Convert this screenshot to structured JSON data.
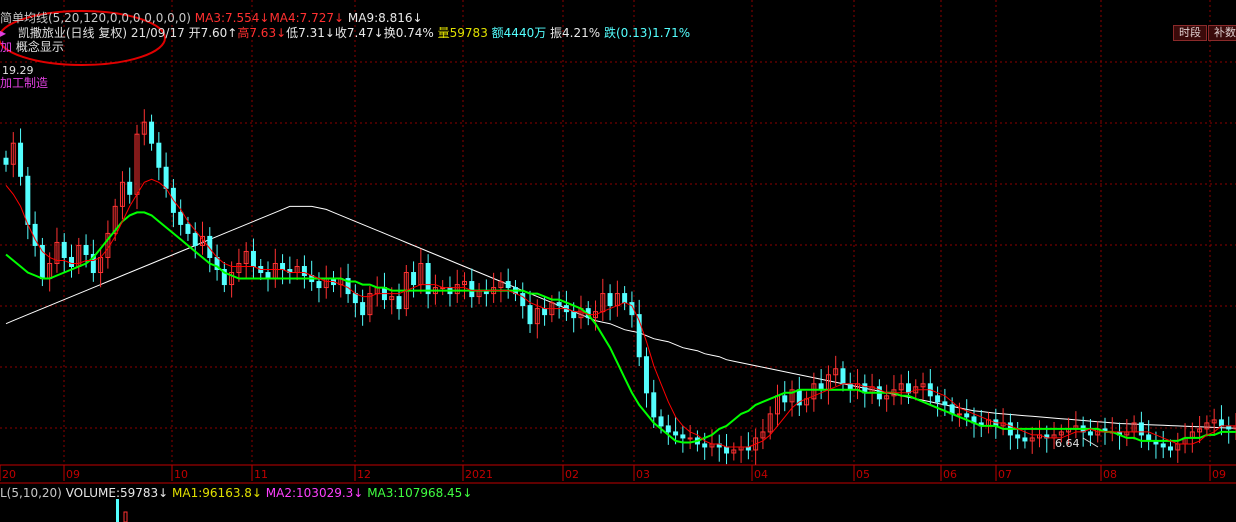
{
  "header": {
    "indicator_name": "简单均线(5,20,120,0,0,0,0,0,0,0)",
    "ma3": "MA3:7.554↓",
    "ma4": "MA4:7.727↓",
    "ma9": "MA9:8.816↓",
    "stock_line": "凯撒旅业(日线 复权) 21/09/17",
    "open": "开7.60↑",
    "high": "高7.63↓",
    "low": "低7.31↓",
    "close": "收7.47↓",
    "turnover": "换0.74%",
    "volume": "量59783",
    "amount": "额4440万",
    "amplitude": "振4.21%",
    "change": "跌(0.13)1.71%",
    "concept_prefix": "加",
    "concept_label": "概念显示",
    "industry": "加工制造"
  },
  "buttons": {
    "timeframe": "时段",
    "supplement": "补数据"
  },
  "volume_header": {
    "params": "L(5,10,20)",
    "volume": "VOLUME:59783↓",
    "ma1": "MA1:96163.8↓",
    "ma2": "MA2:103029.3↓",
    "ma3": "MA3:107968.45↓"
  },
  "colors": {
    "up": "#ff3232",
    "down": "#54ffff",
    "ma_short": "#ff0000",
    "ma_mid": "#00ff00",
    "ma_long": "#ffffff",
    "grid": "#8b0000",
    "axis": "#c00000"
  },
  "chart_data": {
    "type": "candlestick",
    "stock": "凯撒旅业",
    "x_tick_labels": [
      "20",
      "09",
      "10",
      "11",
      "12",
      "2021",
      "02",
      "03",
      "04",
      "05",
      "06",
      "07",
      "08",
      "09"
    ],
    "annotations": {
      "high_marker": "19.29",
      "low_marker": "6.64"
    },
    "y_range": [
      6.3,
      19.6
    ],
    "close": [
      16.2,
      16.9,
      15.8,
      14.2,
      13.5,
      12.4,
      12.9,
      13.6,
      13.1,
      12.8,
      13.5,
      13.2,
      12.6,
      13.1,
      13.9,
      14.8,
      15.6,
      15.2,
      17.2,
      17.6,
      16.9,
      16.1,
      15.4,
      14.6,
      14.2,
      13.9,
      13.5,
      13.8,
      13.1,
      12.7,
      12.2,
      12.6,
      12.9,
      13.3,
      12.8,
      12.6,
      12.4,
      12.9,
      12.7,
      12.6,
      12.8,
      12.5,
      12.3,
      12.1,
      12.4,
      12.2,
      12.4,
      11.9,
      11.6,
      11.2,
      11.9,
      12.1,
      11.7,
      11.8,
      11.4,
      12.6,
      12.2,
      12.9,
      11.9,
      12.1,
      12.1,
      11.9,
      12.2,
      12.3,
      11.8,
      12.0,
      11.9,
      12.1,
      12.3,
      12.1,
      11.9,
      11.5,
      10.9,
      11.4,
      11.2,
      11.6,
      11.5,
      11.3,
      11.1,
      11.4,
      11.1,
      11.3,
      11.9,
      11.5,
      11.9,
      11.6,
      11.2,
      9.8,
      8.6,
      7.8,
      7.5,
      7.3,
      7.2,
      7.1,
      7.1,
      6.9,
      6.8,
      6.9,
      6.8,
      6.6,
      6.7,
      6.8,
      6.7,
      7.1,
      7.3,
      7.9,
      8.5,
      8.3,
      8.7,
      8.2,
      8.4,
      8.9,
      8.7,
      9.2,
      9.4,
      8.9,
      8.7,
      8.9,
      8.6,
      8.8,
      8.4,
      8.5,
      8.7,
      8.9,
      8.6,
      8.8,
      8.9,
      8.5,
      8.3,
      8.2,
      7.9,
      7.9,
      7.8,
      7.6,
      7.5,
      7.7,
      7.5,
      7.6,
      7.2,
      7.1,
      7.0,
      7.1,
      7.2,
      7.1,
      7.2,
      7.3,
      7.4,
      7.5,
      7.3,
      7.2,
      7.4,
      7.3,
      7.3,
      7.2,
      7.3,
      7.6,
      7.2,
      7.0,
      6.9,
      6.8,
      6.7,
      6.9,
      7.1,
      7.3,
      7.4,
      7.6,
      7.7,
      7.5,
      7.4,
      7.5
    ],
    "ma_short": [
      15.5,
      15.2,
      14.8,
      14.2,
      13.7,
      13.3,
      13.1,
      13.0,
      13.0,
      12.9,
      12.9,
      13.0,
      13.0,
      13.1,
      13.4,
      13.8,
      14.3,
      14.8,
      15.2,
      15.6,
      15.7,
      15.6,
      15.4,
      15.0,
      14.7,
      14.3,
      14.0,
      13.7,
      13.4,
      13.1,
      12.9,
      12.8,
      12.8,
      12.8,
      12.8,
      12.7,
      12.7,
      12.7,
      12.7,
      12.6,
      12.6,
      12.6,
      12.5,
      12.4,
      12.3,
      12.3,
      12.2,
      12.1,
      11.9,
      11.8,
      11.8,
      11.9,
      11.9,
      11.9,
      11.9,
      12.0,
      12.1,
      12.2,
      12.2,
      12.2,
      12.1,
      12.1,
      12.1,
      12.1,
      12.0,
      12.0,
      12.0,
      12.0,
      12.0,
      12.0,
      11.9,
      11.8,
      11.6,
      11.5,
      11.4,
      11.4,
      11.4,
      11.4,
      11.3,
      11.3,
      11.2,
      11.2,
      11.3,
      11.4,
      11.5,
      11.6,
      11.5,
      11.0,
      10.3,
      9.5,
      8.9,
      8.3,
      7.8,
      7.5,
      7.3,
      7.2,
      7.0,
      6.9,
      6.9,
      6.8,
      6.8,
      6.8,
      6.8,
      6.9,
      7.0,
      7.2,
      7.5,
      7.8,
      8.1,
      8.3,
      8.4,
      8.5,
      8.6,
      8.7,
      8.8,
      8.9,
      8.9,
      8.9,
      8.8,
      8.8,
      8.7,
      8.6,
      8.6,
      8.6,
      8.6,
      8.7,
      8.7,
      8.7,
      8.6,
      8.5,
      8.3,
      8.1,
      8.0,
      7.9,
      7.8,
      7.7,
      7.6,
      7.6,
      7.5,
      7.4,
      7.3,
      7.2,
      7.2,
      7.1,
      7.1,
      7.1,
      7.2,
      7.3,
      7.3,
      7.4,
      7.3,
      7.3,
      7.3,
      7.3,
      7.3,
      7.3,
      7.3,
      7.3,
      7.2,
      7.1,
      7.0,
      6.9,
      6.9,
      6.9,
      7.0,
      7.2,
      7.3,
      7.5,
      7.5,
      7.5,
      7.5
    ],
    "ma_mid": [
      13.2,
      13.0,
      12.8,
      12.6,
      12.5,
      12.4,
      12.4,
      12.5,
      12.6,
      12.7,
      12.8,
      12.9,
      13.1,
      13.4,
      13.7,
      14.0,
      14.3,
      14.5,
      14.6,
      14.6,
      14.5,
      14.3,
      14.1,
      13.9,
      13.7,
      13.5,
      13.3,
      13.1,
      12.9,
      12.8,
      12.6,
      12.5,
      12.4,
      12.4,
      12.4,
      12.4,
      12.4,
      12.4,
      12.4,
      12.4,
      12.4,
      12.4,
      12.4,
      12.4,
      12.4,
      12.4,
      12.4,
      12.3,
      12.3,
      12.2,
      12.2,
      12.1,
      12.1,
      12.0,
      12.0,
      12.0,
      12.0,
      12.0,
      12.0,
      12.0,
      12.0,
      12.0,
      12.0,
      12.0,
      12.0,
      12.0,
      12.0,
      12.0,
      12.0,
      12.0,
      12.0,
      12.0,
      11.9,
      11.9,
      11.8,
      11.7,
      11.7,
      11.6,
      11.5,
      11.4,
      11.2,
      10.9,
      10.5,
      10.1,
      9.6,
      9.1,
      8.6,
      8.2,
      7.9,
      7.6,
      7.4,
      7.2,
      7.0,
      6.95,
      6.95,
      7.0,
      7.1,
      7.2,
      7.4,
      7.5,
      7.7,
      7.9,
      8.0,
      8.2,
      8.3,
      8.4,
      8.5,
      8.6,
      8.6,
      8.7,
      8.7,
      8.7,
      8.7,
      8.7,
      8.7,
      8.7,
      8.7,
      8.7,
      8.6,
      8.6,
      8.6,
      8.6,
      8.6,
      8.5,
      8.5,
      8.4,
      8.3,
      8.2,
      8.1,
      8.0,
      7.9,
      7.8,
      7.7,
      7.6,
      7.5,
      7.5,
      7.5,
      7.4,
      7.4,
      7.4,
      7.4,
      7.4,
      7.4,
      7.4,
      7.4,
      7.4,
      7.4,
      7.4,
      7.4,
      7.4,
      7.4,
      7.3,
      7.3,
      7.2,
      7.1,
      7.1,
      7.0,
      7.0,
      7.0,
      7.0,
      7.0,
      7.0,
      7.1,
      7.1,
      7.1,
      7.2,
      7.2,
      7.3,
      7.3,
      7.3,
      7.3
    ],
    "ma_long": [
      10.9,
      11.0,
      11.1,
      11.2,
      11.3,
      11.4,
      11.5,
      11.6,
      11.7,
      11.8,
      11.9,
      12.0,
      12.1,
      12.2,
      12.3,
      12.4,
      12.5,
      12.6,
      12.7,
      12.8,
      12.9,
      13.0,
      13.1,
      13.2,
      13.3,
      13.4,
      13.5,
      13.6,
      13.7,
      13.8,
      13.9,
      14.0,
      14.1,
      14.2,
      14.3,
      14.4,
      14.5,
      14.6,
      14.7,
      14.8,
      14.8,
      14.8,
      14.8,
      14.75,
      14.7,
      14.6,
      14.5,
      14.4,
      14.3,
      14.2,
      14.1,
      14.0,
      13.9,
      13.8,
      13.7,
      13.6,
      13.5,
      13.4,
      13.3,
      13.2,
      13.1,
      13.0,
      12.9,
      12.8,
      12.7,
      12.6,
      12.5,
      12.4,
      12.3,
      12.2,
      12.1,
      12.0,
      11.9,
      11.8,
      11.7,
      11.6,
      11.5,
      11.4,
      11.3,
      11.2,
      11.1,
      11.0,
      10.95,
      10.9,
      10.8,
      10.7,
      10.65,
      10.6,
      10.5,
      10.4,
      10.35,
      10.3,
      10.2,
      10.1,
      10.05,
      10.0,
      9.9,
      9.85,
      9.8,
      9.7,
      9.65,
      9.6,
      9.55,
      9.5,
      9.45,
      9.4,
      9.35,
      9.3,
      9.25,
      9.2,
      9.15,
      9.1,
      9.05,
      9.0,
      8.95,
      8.9,
      8.85,
      8.8,
      8.75,
      8.7,
      8.65,
      8.6,
      8.55,
      8.5,
      8.45,
      8.4,
      8.35,
      8.3,
      8.25,
      8.2,
      8.15,
      8.1,
      8.05,
      8.0,
      7.98,
      7.95,
      7.92,
      7.9,
      7.88,
      7.86,
      7.84,
      7.82,
      7.8,
      7.78,
      7.76,
      7.74,
      7.72,
      7.7,
      7.68,
      7.66,
      7.64,
      7.62,
      7.6,
      7.58,
      7.57,
      7.56,
      7.55,
      7.54,
      7.53,
      7.52,
      7.51,
      7.5,
      7.49,
      7.48,
      7.47,
      7.46,
      7.45,
      7.44,
      7.43,
      7.42,
      7.41,
      7.4,
      7.39,
      7.38,
      7.37
    ]
  }
}
